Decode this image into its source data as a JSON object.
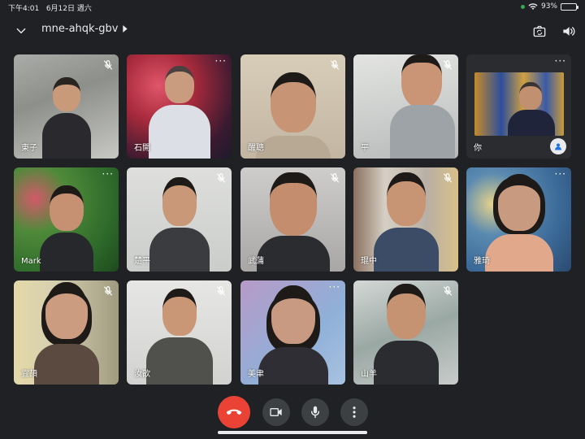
{
  "status_bar": {
    "time": "下午4:01",
    "date": "6月12日 週六",
    "battery": "93%",
    "battery_level": 0.93
  },
  "header": {
    "meeting_code": "mne-ahqk-gbv",
    "collapse_icon": "chevron-down-icon",
    "switch_camera_icon": "camera-switch-icon",
    "audio_icon": "speaker-icon"
  },
  "participants": [
    {
      "name": "東子",
      "muted": true
    },
    {
      "name": "石開",
      "muted": false
    },
    {
      "name": "醒聰",
      "muted": true
    },
    {
      "name": "平",
      "muted": true
    },
    {
      "name": "你",
      "muted": false,
      "self": true
    },
    {
      "name": "Mark",
      "muted": false
    },
    {
      "name": "楚平",
      "muted": true
    },
    {
      "name": "武蒲",
      "muted": true
    },
    {
      "name": "琨中",
      "muted": true
    },
    {
      "name": "雅琦",
      "muted": false
    },
    {
      "name": "宜頡",
      "muted": true
    },
    {
      "name": "汝歆",
      "muted": true
    },
    {
      "name": "美聿",
      "muted": false
    },
    {
      "name": "山羊",
      "muted": true
    }
  ],
  "controls": {
    "end_call_icon": "phone-hangup-icon",
    "camera_icon": "video-camera-icon",
    "mic_icon": "microphone-icon",
    "more_icon": "more-vertical-icon"
  },
  "colors": {
    "background": "#202124",
    "end_call": "#ea4335",
    "control": "#3c4043"
  }
}
